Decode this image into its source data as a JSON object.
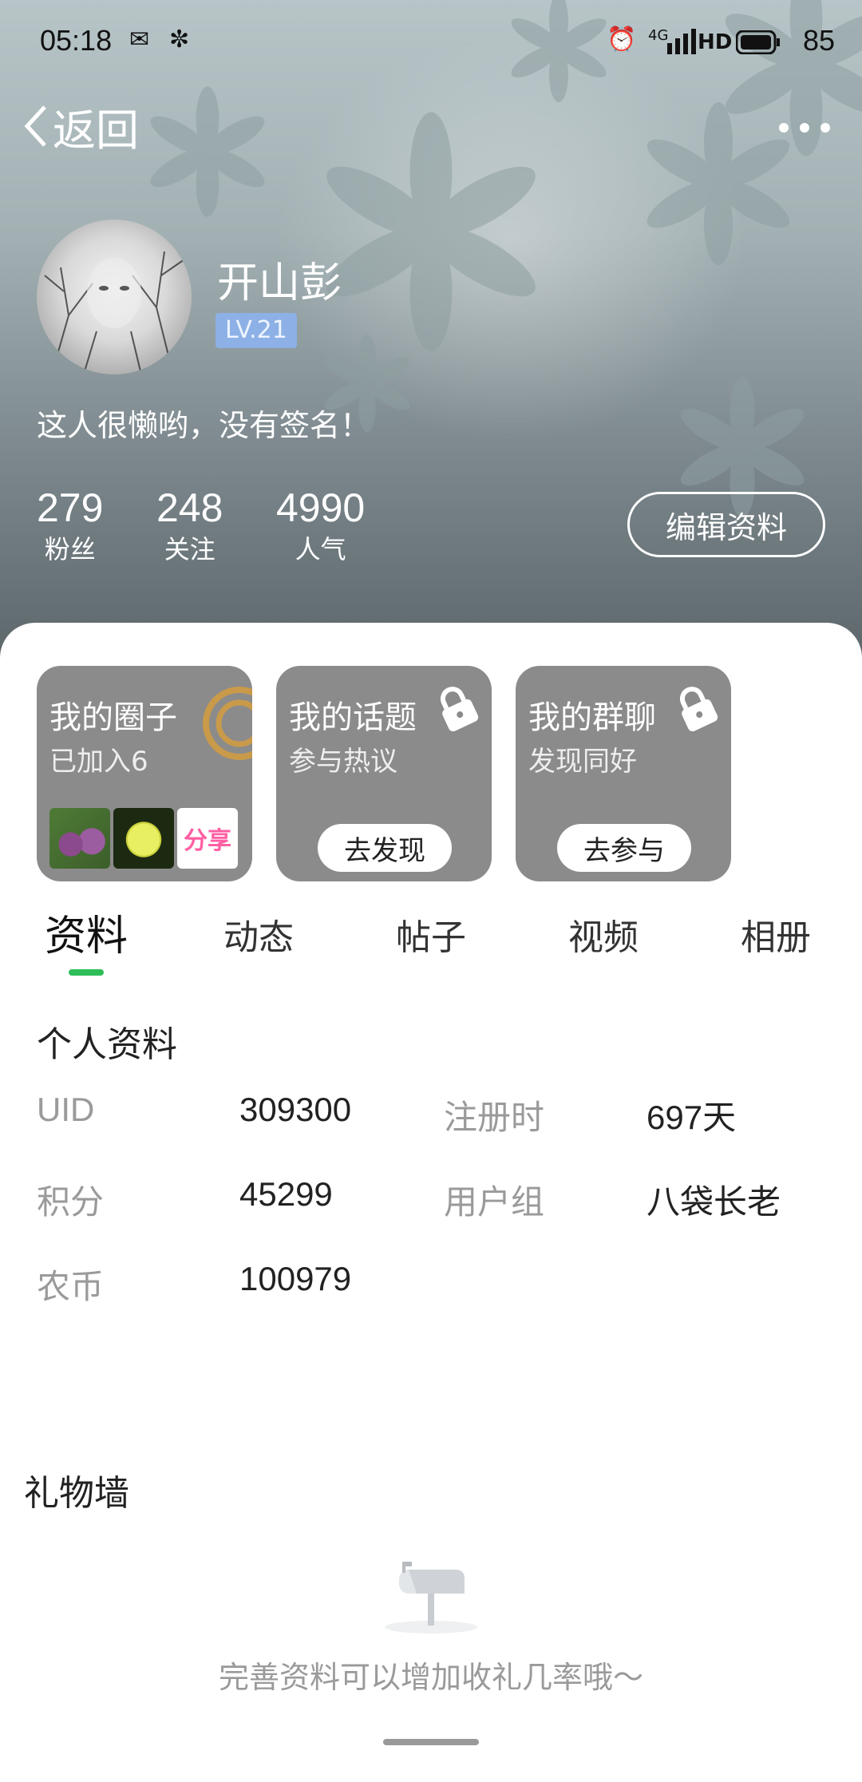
{
  "status_bar": {
    "time": "05:18",
    "network": "4G",
    "battery": "85"
  },
  "header": {
    "back_label": "返回"
  },
  "profile": {
    "name": "开山彭",
    "level": "LV.21",
    "signature": "这人很懒哟，没有签名！",
    "stats": [
      {
        "value": "279",
        "label": "粉丝"
      },
      {
        "value": "248",
        "label": "关注"
      },
      {
        "value": "4990",
        "label": "人气"
      }
    ],
    "edit_button": "编辑资料"
  },
  "tiles": [
    {
      "title": "我的圈子",
      "subtitle": "已加入6",
      "thumb_text": "分享"
    },
    {
      "title": "我的话题",
      "subtitle": "参与热议",
      "button": "去发现"
    },
    {
      "title": "我的群聊",
      "subtitle": "发现同好",
      "button": "去参与"
    }
  ],
  "tabs": [
    "资料",
    "动态",
    "帖子",
    "视频",
    "相册"
  ],
  "active_tab": "资料",
  "accent_color": "#2ebd59",
  "personal_info": {
    "title": "个人资料",
    "fields": [
      {
        "label": "UID",
        "value": "309300"
      },
      {
        "label": "注册时",
        "value": "697天"
      },
      {
        "label": "积分",
        "value": "45299"
      },
      {
        "label": "用户组",
        "value": "八袋长老"
      },
      {
        "label": "农币",
        "value": "100979"
      }
    ]
  },
  "gift_wall": {
    "title": "礼物墙",
    "empty_text": "完善资料可以增加收礼几率哦～",
    "icon": "mailbox-icon"
  }
}
